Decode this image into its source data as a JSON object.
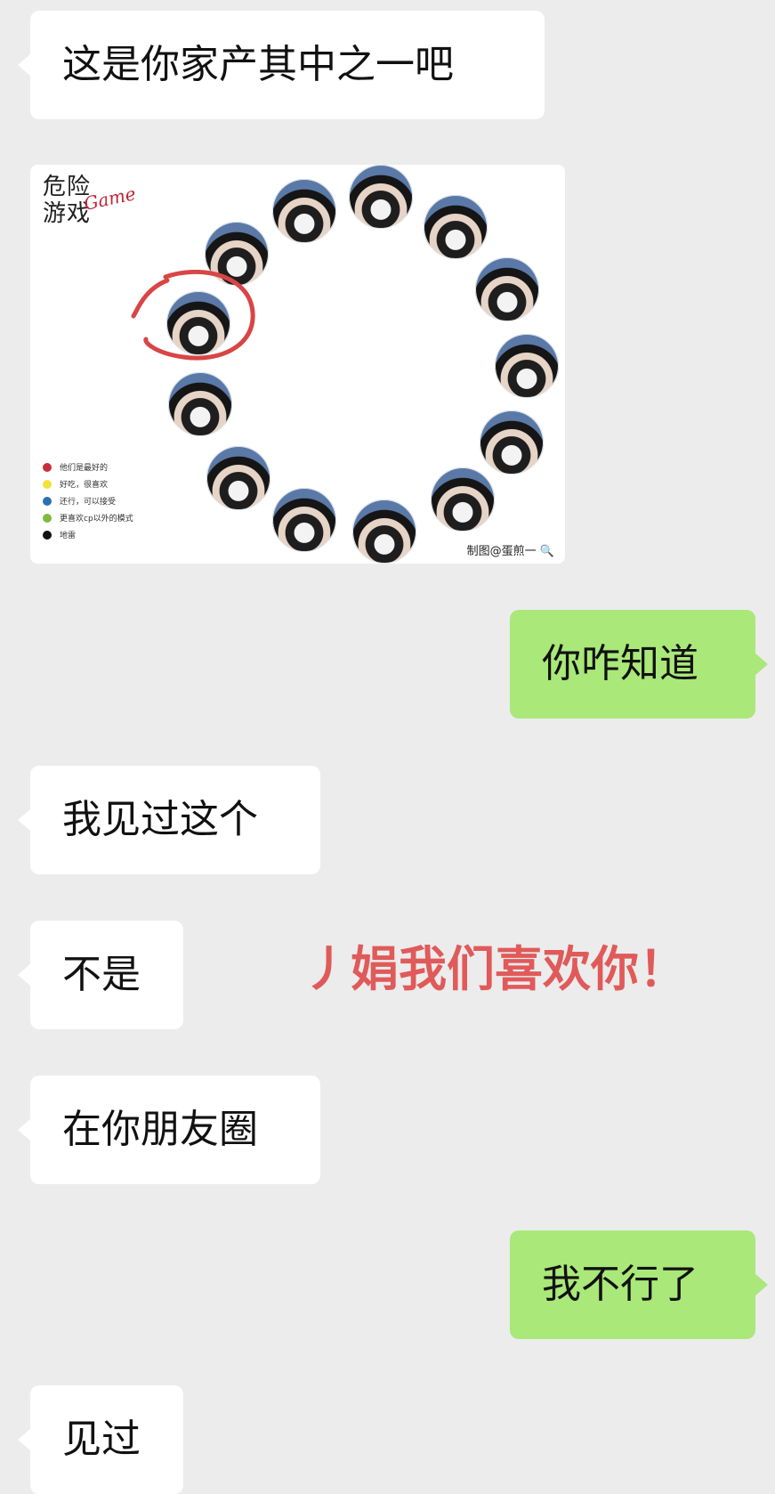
{
  "messages": [
    {
      "side": "left",
      "text": "这是你家产其中之一吧"
    },
    {
      "side": "right",
      "text": "你咋知道"
    },
    {
      "side": "left",
      "text": "我见过这个"
    },
    {
      "side": "left",
      "text": "不是"
    },
    {
      "side": "left",
      "text": "在你朋友圈"
    },
    {
      "side": "right",
      "text": "我不行了"
    },
    {
      "side": "left",
      "text": "见过"
    }
  ],
  "image_message": {
    "title_line1": "危险",
    "title_line2": "游戏",
    "script_text": "Game",
    "legend": [
      {
        "color": "#c92d3a",
        "label": "他们是最好的"
      },
      {
        "color": "#f2e13a",
        "label": "好吃，很喜欢"
      },
      {
        "color": "#2c6fb5",
        "label": "还行，可以接受"
      },
      {
        "color": "#7dbb3f",
        "label": "更喜欢cp以外的模式"
      },
      {
        "color": "#111111",
        "label": "地雷"
      }
    ],
    "credit": "制图@蛋煎一"
  },
  "overlay": {
    "text": "丿娟我们喜欢你！",
    "color": "#e05a5a"
  },
  "colors": {
    "background": "#ececec",
    "bubble_left": "#ffffff",
    "bubble_right": "#a9e879"
  }
}
